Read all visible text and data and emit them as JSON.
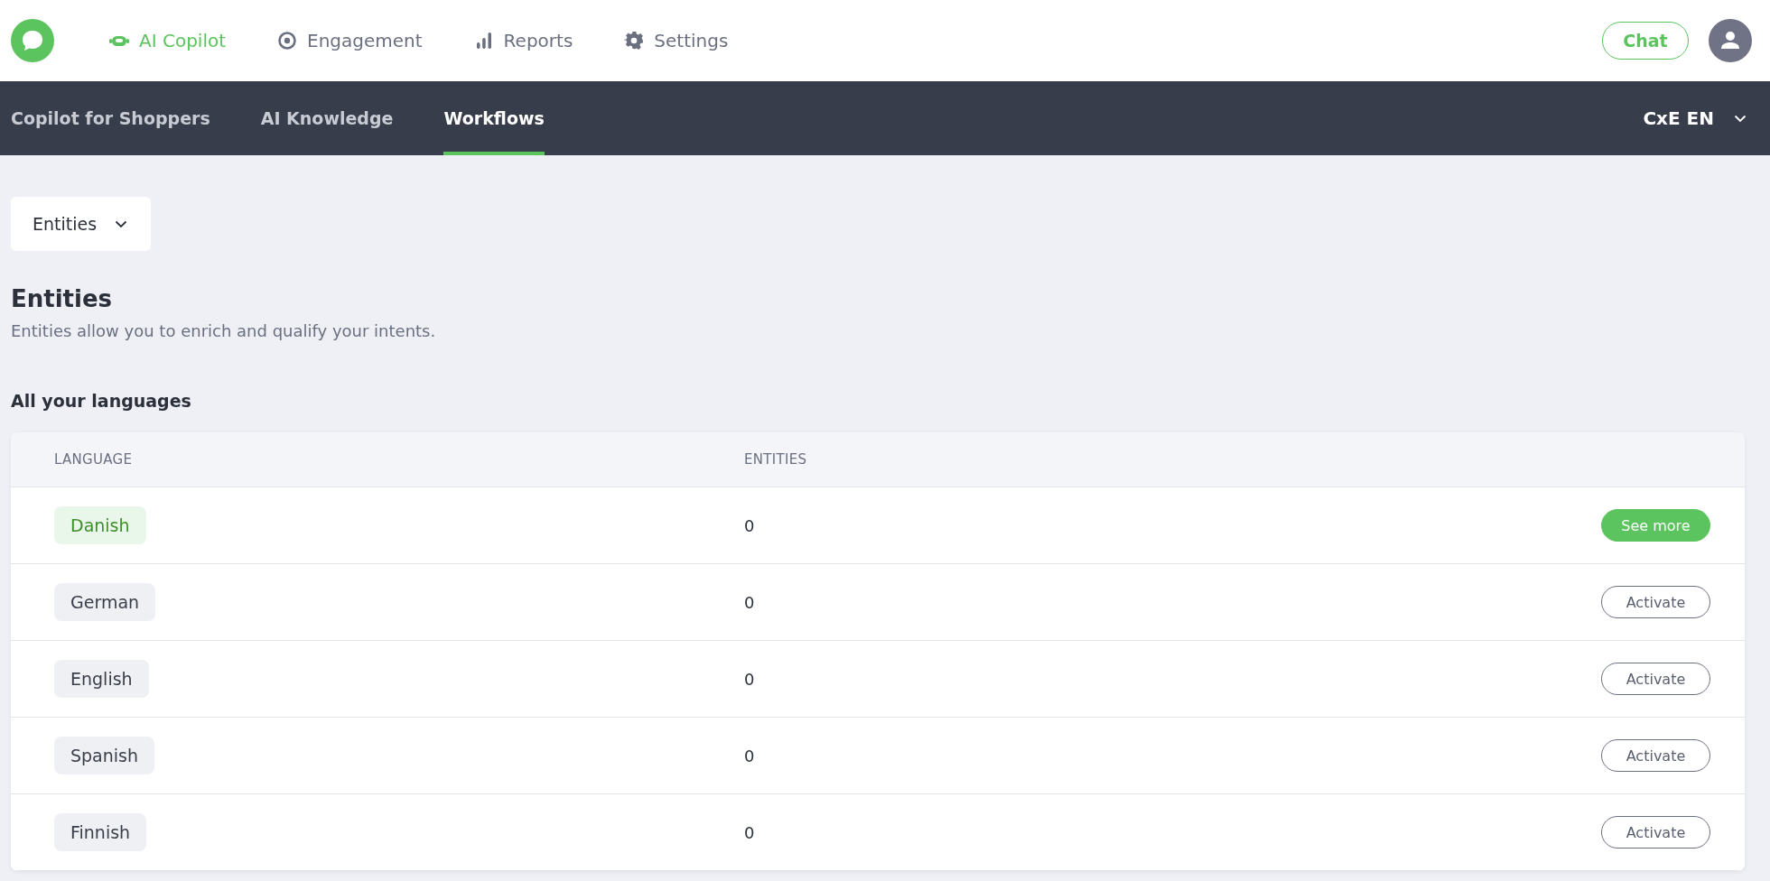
{
  "top_nav": {
    "items": [
      {
        "label": "AI Copilot",
        "selected": true
      },
      {
        "label": "Engagement",
        "selected": false
      },
      {
        "label": "Reports",
        "selected": false
      },
      {
        "label": "Settings",
        "selected": false
      }
    ],
    "chat_button": "Chat"
  },
  "sub_nav": {
    "tabs": [
      {
        "label": "Copilot for Shoppers",
        "selected": false
      },
      {
        "label": "AI Knowledge",
        "selected": false
      },
      {
        "label": "Workflows",
        "selected": true
      }
    ],
    "workspace": "CxE EN"
  },
  "section_dropdown": "Entities",
  "header": {
    "title": "Entities",
    "subtitle": "Entities allow you to enrich and qualify your intents."
  },
  "table": {
    "title": "All your languages",
    "columns": [
      "LANGUAGE",
      "ENTITIES"
    ],
    "rows": [
      {
        "language": "Danish",
        "entities": "0",
        "active": true,
        "action": "See more"
      },
      {
        "language": "German",
        "entities": "0",
        "active": false,
        "action": "Activate"
      },
      {
        "language": "English",
        "entities": "0",
        "active": false,
        "action": "Activate"
      },
      {
        "language": "Spanish",
        "entities": "0",
        "active": false,
        "action": "Activate"
      },
      {
        "language": "Finnish",
        "entities": "0",
        "active": false,
        "action": "Activate"
      }
    ]
  }
}
